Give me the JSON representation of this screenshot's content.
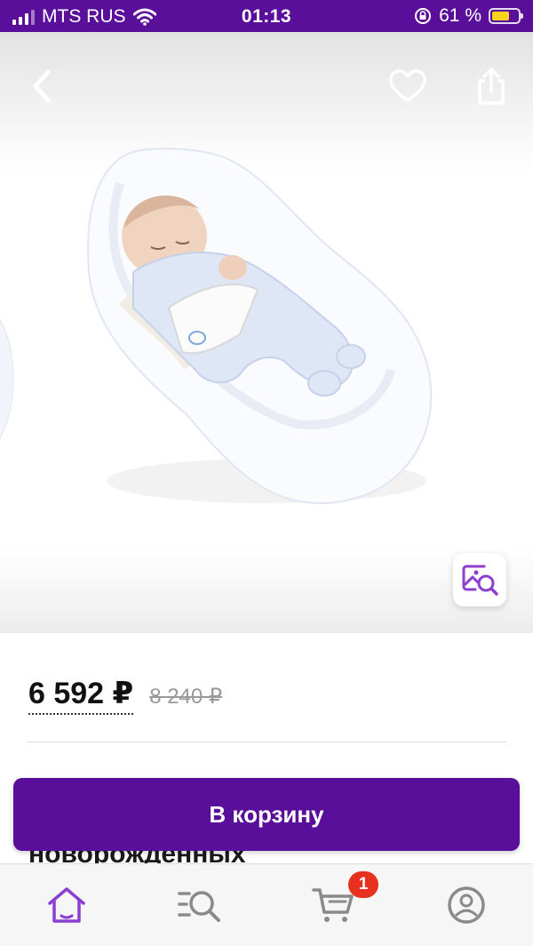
{
  "status_bar": {
    "carrier": "MTS RUS",
    "time": "01:13",
    "battery": "61 %",
    "battery_level": 0.61,
    "icons": [
      "signal-icon",
      "wifi-icon",
      "orientation-lock-icon",
      "battery-icon"
    ]
  },
  "product": {
    "image": "baby-cocoon-mattress-photo",
    "price": "6 592 ₽",
    "old_price": "8 240 ₽",
    "title_partial": "новорожденных"
  },
  "actions": {
    "add_to_cart": "В корзину"
  },
  "tab_bar": {
    "items": [
      "home-icon",
      "catalog-search-icon",
      "cart-icon",
      "profile-icon"
    ],
    "cart_count": "1"
  },
  "colors": {
    "brand": "#5a0f9b",
    "badge": "#e8301f",
    "accent_icon": "#8b3fd1"
  }
}
